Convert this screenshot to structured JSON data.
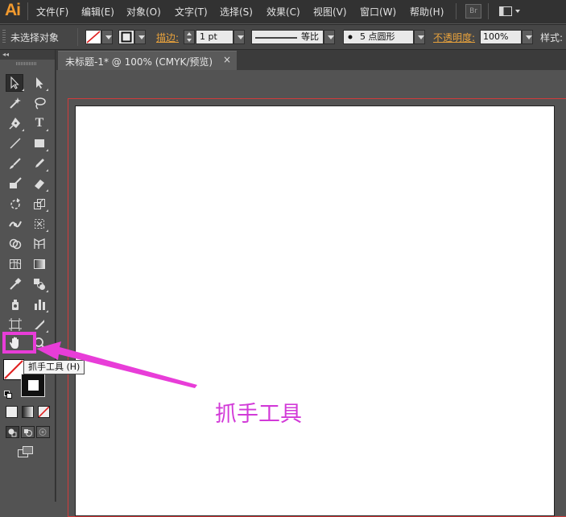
{
  "app": {
    "logo": "Ai"
  },
  "menu": {
    "items": [
      "文件(F)",
      "编辑(E)",
      "对象(O)",
      "文字(T)",
      "选择(S)",
      "效果(C)",
      "视图(V)",
      "窗口(W)",
      "帮助(H)"
    ],
    "bridge_label": "Br"
  },
  "control_bar": {
    "selection_status": "未选择对象",
    "stroke_label": "描边:",
    "stroke_weight": "1 pt",
    "profile_label": "等比",
    "brush_label": "5 点圆形",
    "opacity_label": "不透明度:",
    "opacity_value": "100%",
    "style_label": "样式:"
  },
  "document": {
    "tab_title": "未标题-1* @ 100% (CMYK/预览)",
    "tab_close": "×"
  },
  "colors": {
    "bleed_guide": "#d23a3a",
    "annotation": "#e83dd8",
    "logo": "#f29a2e"
  },
  "tooltip": {
    "text": "抓手工具 (H)"
  },
  "annotation": {
    "label": "抓手工具"
  }
}
